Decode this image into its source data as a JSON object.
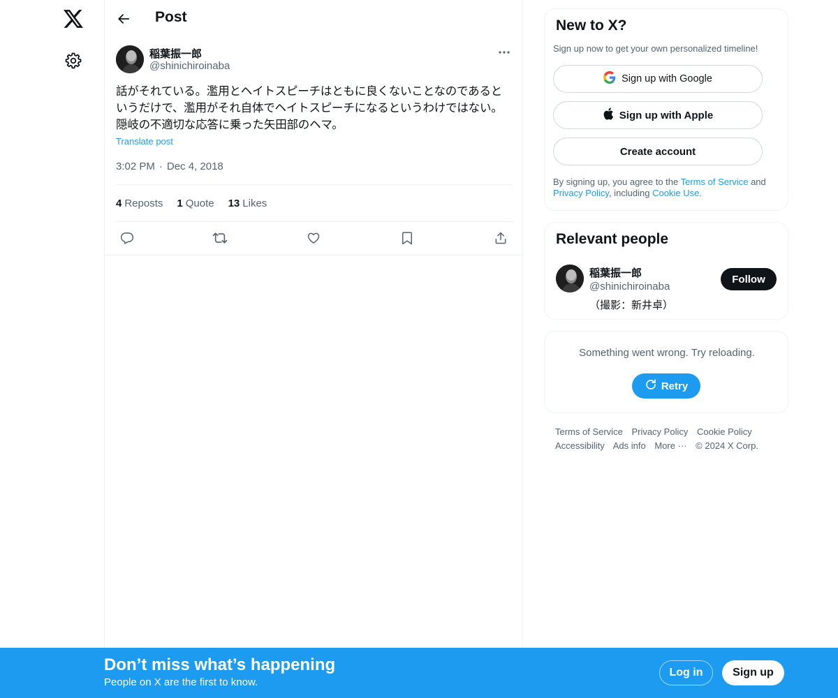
{
  "header": {
    "title": "Post"
  },
  "tweet": {
    "author_name": "稲葉振一郎",
    "author_handle": "@shinichiroinaba",
    "text": "話がそれている。濫用とヘイトスピーチはともに良くないことなのであるというだけで、濫用がそれ自体でヘイトスピーチになるというわけではない。隠岐の不適切な応答に乗った矢田部のヘマ。",
    "translate_label": "Translate post",
    "time": "3:02 PM",
    "date": "Dec 4, 2018",
    "stats": {
      "reposts_count": "4",
      "reposts_label": "Reposts",
      "quote_count": "1",
      "quote_label": "Quote",
      "likes_count": "13",
      "likes_label": "Likes"
    }
  },
  "signup_card": {
    "title": "New to X?",
    "subtitle": "Sign up now to get your own personalized timeline!",
    "google_label": "Sign up with Google",
    "apple_label": "Sign up with Apple",
    "create_label": "Create account",
    "legal_prefix": "By signing up, you agree to the",
    "terms_link": "Terms of Service",
    "and_text": "and",
    "privacy_link": "Privacy Policy",
    "including_text": ", including",
    "cookie_link": "Cookie Use."
  },
  "relevant_people": {
    "title": "Relevant people",
    "name": "稲葉振一郎",
    "handle": "@shinichiroinaba",
    "bio": "（撮影：新井卓）",
    "follow_label": "Follow"
  },
  "error_card": {
    "message": "Something went wrong. Try reloading.",
    "retry_label": "Retry"
  },
  "footer": {
    "links": [
      "Terms of Service",
      "Privacy Policy",
      "Cookie Policy",
      "Accessibility",
      "Ads info",
      "More ···",
      "© 2024 X Corp."
    ]
  },
  "bottom_bar": {
    "title": "Don’t miss what’s happening",
    "subtitle": "People on X are the first to know.",
    "login_label": "Log in",
    "signup_label": "Sign up"
  },
  "colors": {
    "accent": "#1d9bf0",
    "text": "#0f1419",
    "muted": "#536471",
    "border": "#eff3f4"
  },
  "icons": [
    "x-logo-icon",
    "gear-icon",
    "back-arrow-icon",
    "more-icon",
    "reply-icon",
    "repost-icon",
    "like-icon",
    "bookmark-icon",
    "share-icon",
    "google-icon",
    "apple-icon",
    "refresh-icon"
  ]
}
